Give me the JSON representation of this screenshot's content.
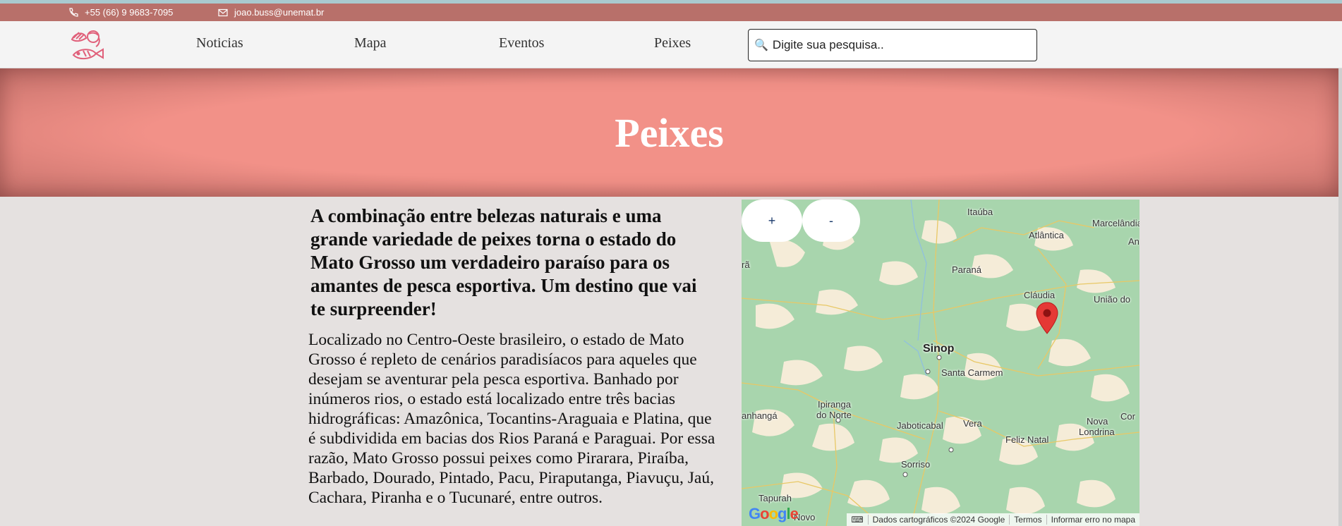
{
  "contact": {
    "phone": "+55 (66) 9 9683-7095",
    "email": "joao.buss@unemat.br"
  },
  "nav": {
    "links": [
      "Noticias",
      "Mapa",
      "Eventos",
      "Peixes"
    ],
    "search_placeholder": "Digite sua pesquisa.."
  },
  "hero": {
    "title": "Peixes"
  },
  "content": {
    "lead": "A combinação entre belezas naturais e uma grande variedade de peixes torna o estado do Mato Grosso um verdadeiro paraíso para os amantes de pesca esportiva. Um destino que vai te surpreender!",
    "body": "Localizado no Centro-Oeste brasileiro, o estado de Mato Grosso é repleto de cenários paradisíacos para aqueles que desejam se aventurar pela pesca esportiva. Banhado por inúmeros rios, o estado está localizado entre três bacias hidrográficas: Amazônica, Tocantins-Araguaia e Platina, que é subdividida em bacias dos Rios Paraná e Paraguai. Por essa razão, Mato Grosso possui peixes como Pirarara, Piraíba, Barbado, Dourado, Pintado, Pacu, Piraputanga, Piavuçu, Jaú, Cachara, Piranha e o Tucunaré, entre outros."
  },
  "map": {
    "zoom_in": "+",
    "zoom_out": "-",
    "places": {
      "itauba": "Itaúba",
      "marcelandia": "Marcelândia",
      "atlantica": "Atlântica",
      "an": "An",
      "ra": "rã",
      "parana": "Paraná",
      "claudia": "Cláudia",
      "uniao": "União do",
      "sinop": "Sinop",
      "santa_carmem": "Santa Carmem",
      "ipiranga": "Ipiranga",
      "do_norte": "do Norte",
      "anhanga": "anhangá",
      "jaboticabal": "Jaboticabal",
      "vera": "Vera",
      "nova": "Nova",
      "londrina": "Londrina",
      "cor": "Cor",
      "feliz_natal": "Feliz Natal",
      "sorriso": "Sorriso",
      "tapurah": "Tapurah",
      "novo": "Novo"
    },
    "google": "Google",
    "attribution": {
      "data": "Dados cartográficos ©2024 Google",
      "terms": "Termos",
      "report": "Informar erro no mapa"
    },
    "colors": {
      "forest": "#a8d5ad",
      "land": "#f5ecd8",
      "pin": "#e53935"
    }
  }
}
